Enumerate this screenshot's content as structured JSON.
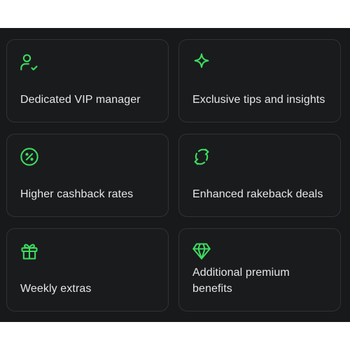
{
  "accent_color": "#3ddc5f",
  "cards": [
    {
      "icon": "user-check-icon",
      "label": "Dedicated VIP manager"
    },
    {
      "icon": "sparkle-icon",
      "label": "Exclusive tips and insights"
    },
    {
      "icon": "percent-badge-icon",
      "label": "Higher cashback rates"
    },
    {
      "icon": "refresh-icon",
      "label": "Enhanced rakeback deals"
    },
    {
      "icon": "gift-icon",
      "label": "Weekly extras"
    },
    {
      "icon": "diamond-icon",
      "label": "Additional premium benefits"
    }
  ]
}
